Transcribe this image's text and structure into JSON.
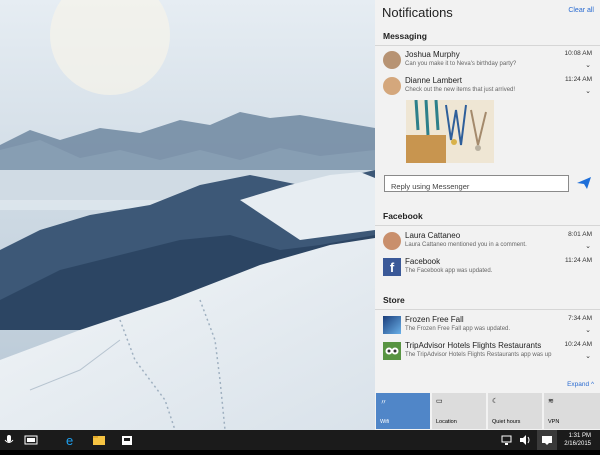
{
  "panel": {
    "title": "Notifications",
    "clear_all": "Clear all",
    "expand": "Expand ^"
  },
  "sections": {
    "messaging": {
      "title": "Messaging",
      "items": [
        {
          "name": "Joshua Murphy",
          "message": "Can you make it to Neva's birthday party?",
          "time": "10:08 AM",
          "icon": "avatar-joshua"
        },
        {
          "name": "Dianne Lambert",
          "message": "Check out the new items that just arrived!",
          "time": "11:24 AM",
          "icon": "avatar-dianne"
        }
      ],
      "reply_placeholder": "Reply using Messenger"
    },
    "facebook": {
      "title": "Facebook",
      "items": [
        {
          "name": "Laura Cattaneo",
          "message": "Laura Cattaneo mentioned you in a comment.",
          "time": "8:01 AM",
          "icon": "avatar-laura"
        },
        {
          "name": "Facebook",
          "message": "The Facebook app was updated.",
          "time": "11:24 AM",
          "icon": "facebook-icon"
        }
      ]
    },
    "store": {
      "title": "Store",
      "items": [
        {
          "name": "Frozen Free Fall",
          "message": "The Frozen Free Fall app was updated.",
          "time": "7:34 AM",
          "icon": "frozen-app-icon"
        },
        {
          "name": "TripAdvisor Hotels Flights Restaurants",
          "message": "The TripAdvisor Hotels Flights Restaurants app was up",
          "time": "10:24 AM",
          "icon": "tripadvisor-icon"
        }
      ]
    }
  },
  "quick_actions": [
    {
      "label": "Wifi",
      "icon": "wifi-icon",
      "active": true
    },
    {
      "label": "Location",
      "icon": "location-icon",
      "active": false
    },
    {
      "label": "Quiet hours",
      "icon": "moon-icon",
      "active": false
    },
    {
      "label": "VPN",
      "icon": "vpn-icon",
      "active": false
    }
  ],
  "taskbar": {
    "time": "1:31 PM",
    "date": "2/16/2015"
  },
  "colors": {
    "accent": "#2a6bd1",
    "active_tile": "#5086c8",
    "taskbar": "#1b1b1b",
    "panel": "#f2f2f2"
  }
}
